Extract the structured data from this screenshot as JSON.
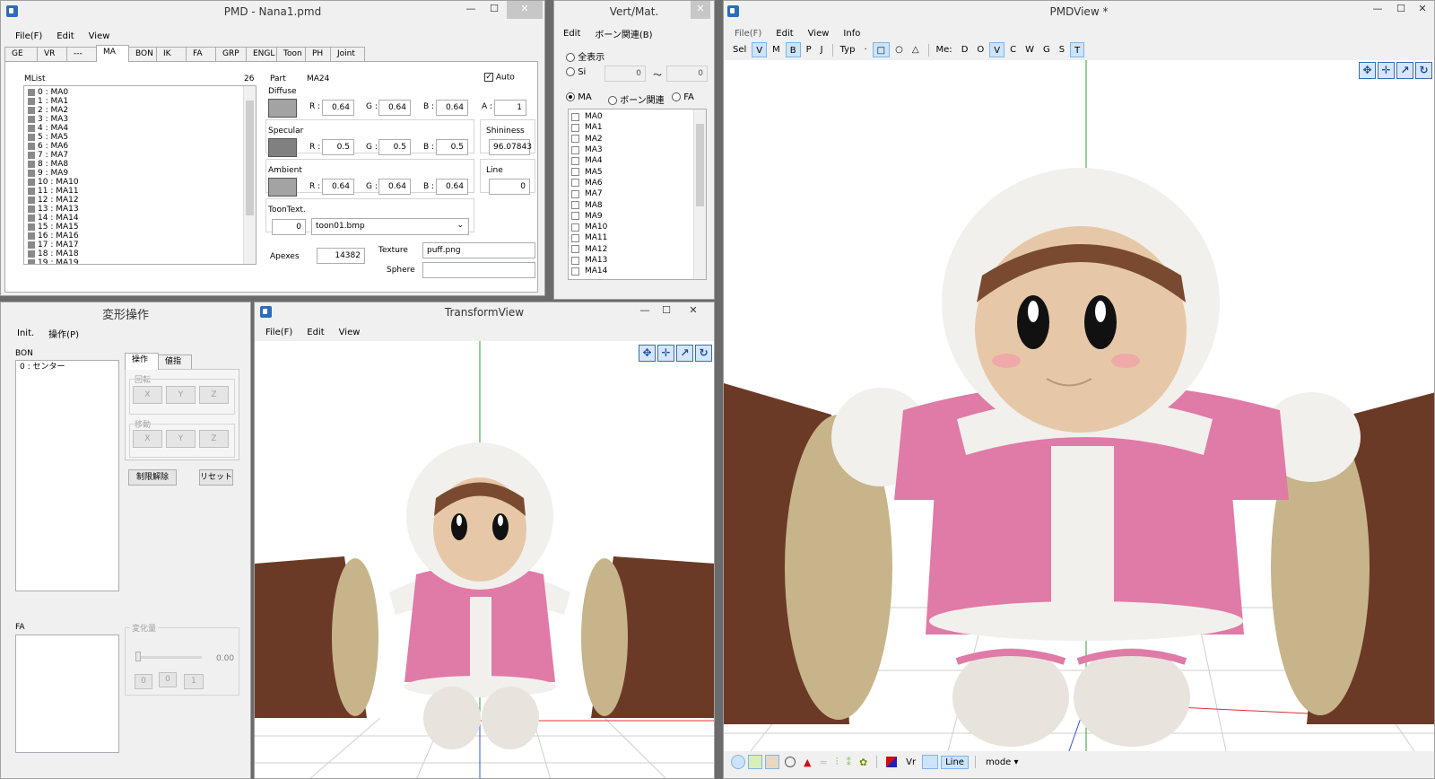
{
  "pmd": {
    "title": "PMD   - Nana1.pmd",
    "menu": [
      "File(F)",
      "Edit",
      "View"
    ],
    "tabs": [
      "GE",
      "VR",
      "---",
      "MA",
      "BON",
      "IK",
      "FA",
      "GRP",
      "ENGL",
      "Toon",
      "PH",
      "Joint"
    ],
    "mlist": {
      "label": "MList",
      "count": "26",
      "items": [
        "0 : MA0",
        "1 : MA1",
        "2 : MA2",
        "3 : MA3",
        "4 : MA4",
        "5 : MA5",
        "6 : MA6",
        "7 : MA7",
        "8 : MA8",
        "9 : MA9",
        "10 : MA10",
        "11 : MA11",
        "12 : MA12",
        "13 : MA13",
        "14 : MA14",
        "15 : MA15",
        "16 : MA16",
        "17 : MA17",
        "18 : MA18",
        "19 : MA19"
      ]
    },
    "part_label": "Part",
    "part_value": "MA24",
    "auto_label": "Auto",
    "diffuse_label": "Diffuse",
    "diffuse": {
      "r": "0.64",
      "g": "0.64",
      "b": "0.64",
      "a": "1"
    },
    "specular_label": "Specular",
    "specular": {
      "r": "0.5",
      "g": "0.5",
      "b": "0.5"
    },
    "shininess_label": "Shininess",
    "shininess": "96.07843",
    "ambient_label": "Ambient",
    "ambient": {
      "r": "0.64",
      "g": "0.64",
      "b": "0.64"
    },
    "line_label": "Line",
    "line": "0",
    "r_label": "R :",
    "g_label": "G :",
    "b_label": "B :",
    "a_label": "A :",
    "toon_label": "ToonText.",
    "toon_index": "0",
    "toon_file": "toon01.bmp",
    "apexes_label": "Apexes",
    "apexes": "14382",
    "texture_label": "Texture",
    "texture": "puff.png",
    "sphere_label": "Sphere",
    "sphere": ""
  },
  "vert": {
    "title": "Vert/Mat.",
    "menu": [
      "Edit",
      "ボーン関連(B)"
    ],
    "show_all": "全表示",
    "si": "Si",
    "si_from": "0",
    "tilde": "～",
    "si_to": "0",
    "radio_ma": "MA",
    "radio_bone": "ボーン関連",
    "radio_fa": "FA",
    "items": [
      "MA0",
      "MA1",
      "MA2",
      "MA3",
      "MA4",
      "MA5",
      "MA6",
      "MA7",
      "MA8",
      "MA9",
      "MA10",
      "MA11",
      "MA12",
      "MA13",
      "MA14"
    ]
  },
  "transform": {
    "title": "変形操作",
    "menu": [
      "Init.",
      "操作(P)"
    ],
    "bon_label": "BON",
    "bon_items": [
      "0 : センター"
    ],
    "tab_op": "操作",
    "tab_val": "値指定",
    "rot_label": "回転",
    "move_label": "移動",
    "x": "X",
    "y": "Y",
    "z": "Z",
    "unlimit": "制限解除",
    "reset": "リセット",
    "fa_label": "FA",
    "delta_label": "変化量",
    "delta_value": "0.00",
    "small_btns": [
      "0",
      "0",
      "1"
    ]
  },
  "tview": {
    "title": "TransformView",
    "menu": [
      "File(F)",
      "Edit",
      "View"
    ]
  },
  "pmdview": {
    "title": "PMDView *",
    "menu": [
      "File(F)",
      "Edit",
      "View",
      "Info"
    ],
    "toolbar": [
      "Sel",
      "V",
      "M",
      "B",
      "P",
      "J",
      "Typ",
      "·",
      "□",
      "○",
      "△",
      "Me:",
      "D",
      "O",
      "V",
      "C",
      "W",
      "G",
      "S",
      "T"
    ],
    "bottom": {
      "vr": "Vr",
      "line": "Line",
      "mode": "mode"
    }
  },
  "window_controls": {
    "min": "—",
    "max": "☐",
    "close": "✕"
  },
  "colors": {
    "swatch_diffuse": "#a3a3a3",
    "swatch_specular": "#808080",
    "swatch_ambient": "#a3a3a3",
    "jacket": "#e07aa6",
    "fur": "#f2f0ec",
    "wood": "#6b3a26"
  }
}
